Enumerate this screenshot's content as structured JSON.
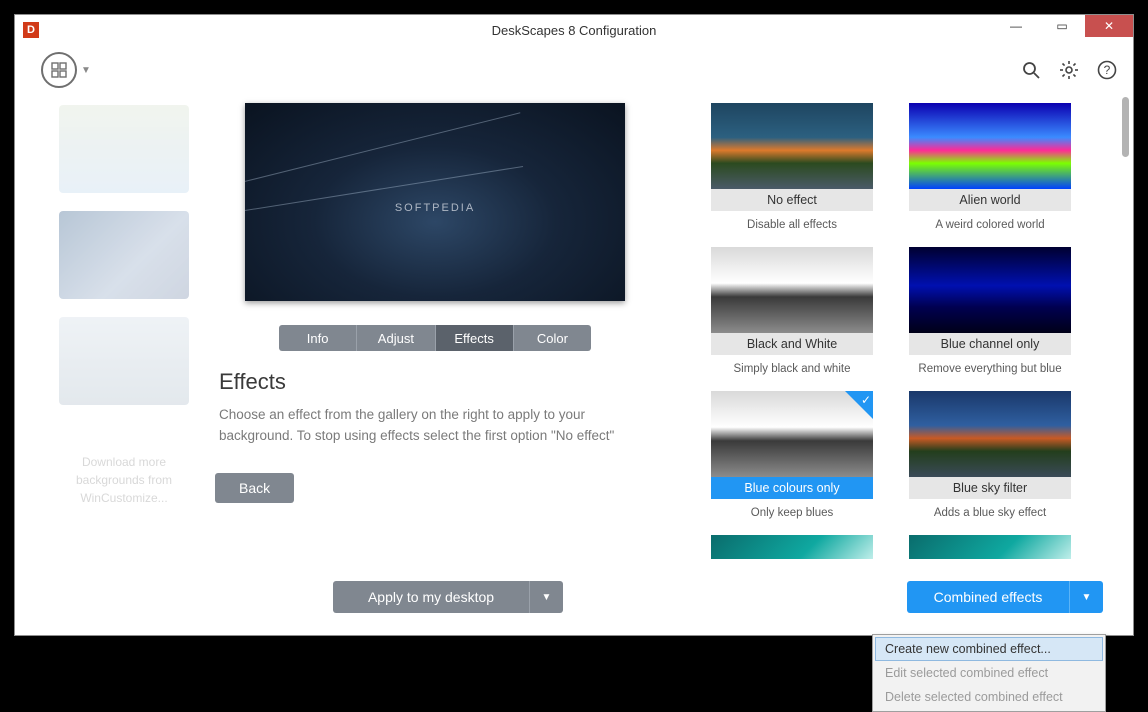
{
  "title": "DeskScapes 8 Configuration",
  "sidebar": {
    "download": "Download more backgrounds from WinCustomize..."
  },
  "center": {
    "watermark": "SOFTPEDIA",
    "tabs": [
      "Info",
      "Adjust",
      "Effects",
      "Color"
    ],
    "active_tab": 2,
    "heading": "Effects",
    "body": "Choose an effect from the gallery on the right to apply to your background.  To stop using effects select the first option \"No effect\"",
    "back": "Back",
    "apply": "Apply to my desktop"
  },
  "effects": [
    {
      "name": "No effect",
      "desc": "Disable all effects",
      "imgclass": "col-sunset",
      "selected": false
    },
    {
      "name": "Alien world",
      "desc": "A weird colored world",
      "imgclass": "col-alien",
      "selected": false
    },
    {
      "name": "Black and White",
      "desc": "Simply black and white",
      "imgclass": "col-bw",
      "selected": false
    },
    {
      "name": "Blue channel only",
      "desc": "Remove everything but blue",
      "imgclass": "col-bluechan",
      "selected": false
    },
    {
      "name": "Blue colours only",
      "desc": "Only keep blues",
      "imgclass": "col-bw",
      "selected": true
    },
    {
      "name": "Blue sky filter",
      "desc": "Adds a blue sky effect",
      "imgclass": "col-bluesky",
      "selected": false
    },
    {
      "name": "",
      "desc": "",
      "imgclass": "col-teal",
      "selected": false
    },
    {
      "name": "",
      "desc": "",
      "imgclass": "col-teal",
      "selected": false
    }
  ],
  "combined": {
    "label": "Combined effects",
    "menu": [
      {
        "label": "Create new combined effect...",
        "enabled": true,
        "hover": true
      },
      {
        "label": "Edit selected combined effect",
        "enabled": false,
        "hover": false
      },
      {
        "label": "Delete selected combined effect",
        "enabled": false,
        "hover": false
      }
    ]
  }
}
